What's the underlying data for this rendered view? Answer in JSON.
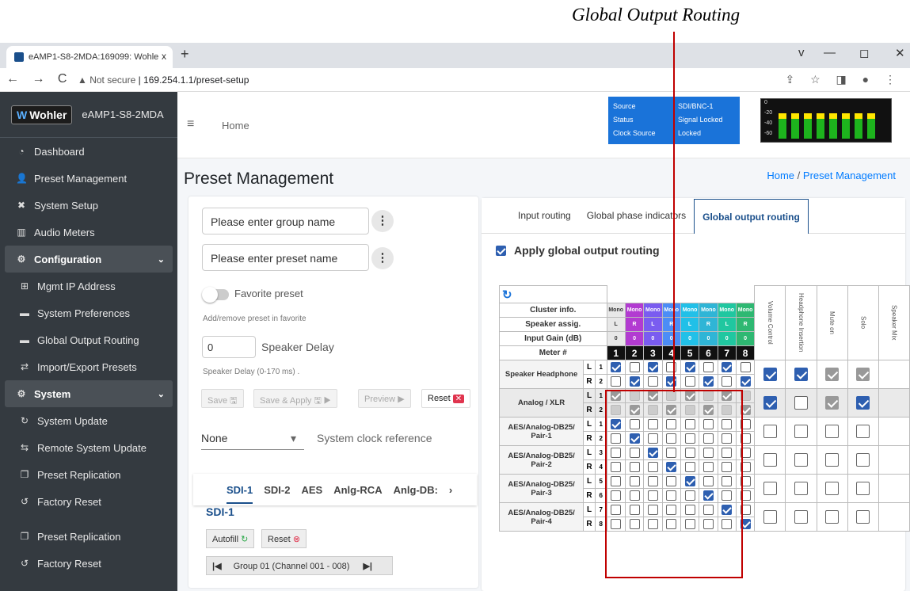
{
  "caption": "Global Output Routing",
  "browser": {
    "tab_title": "eAMP1-S8-2MDA:169099: Wohle",
    "tab_close": "x",
    "new_tab": "+",
    "not_secure": "Not secure",
    "url": "169.254.1.1/preset-setup",
    "nav_icons": "← → C",
    "tools": "⇪ ☆ ◨ ● ⋮",
    "win_min": "—",
    "win_max": "◻",
    "win_close": "✕",
    "chevron": "v"
  },
  "sidebar": {
    "logo": "Wohler",
    "device": "eAMP1-S8-2MDA",
    "items": [
      {
        "label": "Dashboard",
        "icon": "dashboard-icon",
        "glyph": "◔"
      },
      {
        "label": "Preset Management",
        "icon": "users-icon",
        "glyph": "👤"
      },
      {
        "label": "System Setup",
        "icon": "tools-icon",
        "glyph": "✖"
      },
      {
        "label": "Audio Meters",
        "icon": "meter-icon",
        "glyph": "▥"
      },
      {
        "label": "Configuration",
        "icon": "gear-icon",
        "glyph": "⚙"
      },
      {
        "label": "Mgmt IP Address",
        "icon": "network-icon",
        "glyph": "⊞"
      },
      {
        "label": "System Preferences",
        "icon": "panel-icon",
        "glyph": "▬"
      },
      {
        "label": "Global Output Routing",
        "icon": "panel-icon",
        "glyph": "▬"
      },
      {
        "label": "Import/Export Presets",
        "icon": "swap-icon",
        "glyph": "⇄"
      },
      {
        "label": "System",
        "icon": "cogs-icon",
        "glyph": "⚙"
      },
      {
        "label": "System Update",
        "icon": "sync-icon",
        "glyph": "↻"
      },
      {
        "label": "Remote System Update",
        "icon": "remote-icon",
        "glyph": "⇆"
      },
      {
        "label": "Preset Replication",
        "icon": "copy-icon",
        "glyph": "❐"
      },
      {
        "label": "Factory Reset",
        "icon": "undo-icon",
        "glyph": "↺"
      },
      {
        "label": "Preset Replication",
        "icon": "copy-icon",
        "glyph": "❐"
      },
      {
        "label": "Factory Reset",
        "icon": "undo-icon",
        "glyph": "↺"
      }
    ]
  },
  "topbar": {
    "home": "Home",
    "menu_glyph": "≡"
  },
  "status": {
    "source_k": "Source",
    "source_v": "SDI/BNC-1",
    "status_k": "Status",
    "status_v": "Signal Locked",
    "clock_k": "Clock Source",
    "clock_v": "Locked"
  },
  "meter_scale": [
    "0",
    "-20",
    "-40",
    "-60"
  ],
  "page": {
    "title": "Preset Management",
    "crumb_home": "Home",
    "crumb_sep": "/",
    "crumb_current": "Preset Management"
  },
  "left": {
    "group_placeholder": "Please enter group name",
    "preset_placeholder": "Please enter preset name",
    "dots": "⋮",
    "favorite": "Favorite preset",
    "fav_hint": "Add/remove preset in favorite",
    "delay_value": "0",
    "delay_label": "Speaker Delay",
    "delay_hint": "Speaker Delay (0-170 ms) .",
    "save": "Save",
    "save_apply": "Save & Apply",
    "preview": "Preview",
    "reset": "Reset",
    "reset_x": "✕",
    "disk": "🖫",
    "play": "▶",
    "clock_value": "None",
    "clock_caret": "▾",
    "clock_label": "System clock reference",
    "tabs": [
      "SDI-1",
      "SDI-2",
      "AES",
      "Anlg-RCA",
      "Anlg-DB:"
    ],
    "tabs_more": "›",
    "sdi_title": "SDI-1",
    "autofill": "Autofill",
    "autofill_icon": "↻",
    "reset2": "Reset",
    "reset2_icon": "⊗",
    "group_first": "|◀",
    "group_label": "Group 01 (Channel 001 - 008)",
    "group_last": "▶|"
  },
  "right": {
    "tabs": [
      "Input routing",
      "Global phase indicators",
      "Global output routing"
    ],
    "apply_label": "Apply global output routing",
    "refresh": "↻",
    "hdr_labels": [
      "Cluster info.",
      "Speaker assig.",
      "Input Gain (dB)",
      "Meter #"
    ],
    "cluster": [
      "Mono",
      "Mono",
      "Mono",
      "Mono",
      "Mono",
      "Mono",
      "Mono",
      "Mono"
    ],
    "cluster_colors": [
      "#e8e8e8",
      "#b23bd1",
      "#7a5cf0",
      "#4c8df6",
      "#21c0e8",
      "#2fb5d6",
      "#20c7a0",
      "#2eb872"
    ],
    "speaker": [
      "L",
      "R",
      "L",
      "R",
      "L",
      "R",
      "L",
      "R"
    ],
    "gain": [
      "0",
      "0",
      "0",
      "0",
      "0",
      "0",
      "0",
      "0"
    ],
    "meters": [
      "1",
      "2",
      "3",
      "4",
      "5",
      "6",
      "7",
      "8"
    ],
    "side_cols": [
      "Volume Control",
      "Headphone Insertion",
      "Mute on",
      "Solo",
      "Speaker Mix"
    ],
    "rows": [
      {
        "name": "Speaker Headphone",
        "lr": [
          "L",
          "R"
        ],
        "n": [
          "1",
          "2"
        ],
        "bg": "#fff",
        "dis": false,
        "cells": [
          [
            1,
            0,
            1,
            0,
            1,
            0,
            1,
            0
          ],
          [
            0,
            1,
            0,
            1,
            0,
            1,
            0,
            1
          ]
        ],
        "side": [
          1,
          1,
          2,
          2
        ]
      },
      {
        "name": "Analog / XLR",
        "lr": [
          "L",
          "R"
        ],
        "n": [
          "1",
          "2"
        ],
        "bg": "#eaeaea",
        "dis": true,
        "cells": [
          [
            1,
            0,
            1,
            0,
            1,
            0,
            1,
            0
          ],
          [
            0,
            1,
            0,
            1,
            0,
            1,
            0,
            1
          ]
        ],
        "side": [
          1,
          0,
          2,
          1
        ]
      },
      {
        "name": "AES/Analog-DB25/ Pair-1",
        "lr": [
          "L",
          "R"
        ],
        "n": [
          "1",
          "2"
        ],
        "bg": "#fff",
        "dis": false,
        "cells": [
          [
            1,
            0,
            0,
            0,
            0,
            0,
            0,
            0
          ],
          [
            0,
            1,
            0,
            0,
            0,
            0,
            0,
            0
          ]
        ],
        "side": [
          0,
          0,
          0,
          0
        ]
      },
      {
        "name": "AES/Analog-DB25/ Pair-2",
        "lr": [
          "L",
          "R"
        ],
        "n": [
          "3",
          "4"
        ],
        "bg": "#fff",
        "dis": false,
        "cells": [
          [
            0,
            0,
            1,
            0,
            0,
            0,
            0,
            0
          ],
          [
            0,
            0,
            0,
            1,
            0,
            0,
            0,
            0
          ]
        ],
        "side": [
          0,
          0,
          0,
          0
        ]
      },
      {
        "name": "AES/Analog-DB25/ Pair-3",
        "lr": [
          "L",
          "R"
        ],
        "n": [
          "5",
          "6"
        ],
        "bg": "#fff",
        "dis": false,
        "cells": [
          [
            0,
            0,
            0,
            0,
            1,
            0,
            0,
            0
          ],
          [
            0,
            0,
            0,
            0,
            0,
            1,
            0,
            0
          ]
        ],
        "side": [
          0,
          0,
          0,
          0
        ]
      },
      {
        "name": "AES/Analog-DB25/ Pair-4",
        "lr": [
          "L",
          "R"
        ],
        "n": [
          "7",
          "8"
        ],
        "bg": "#fff",
        "dis": false,
        "cells": [
          [
            0,
            0,
            0,
            0,
            0,
            0,
            1,
            0
          ],
          [
            0,
            0,
            0,
            0,
            0,
            0,
            0,
            1
          ]
        ],
        "side": [
          0,
          0,
          0,
          0
        ]
      }
    ]
  }
}
